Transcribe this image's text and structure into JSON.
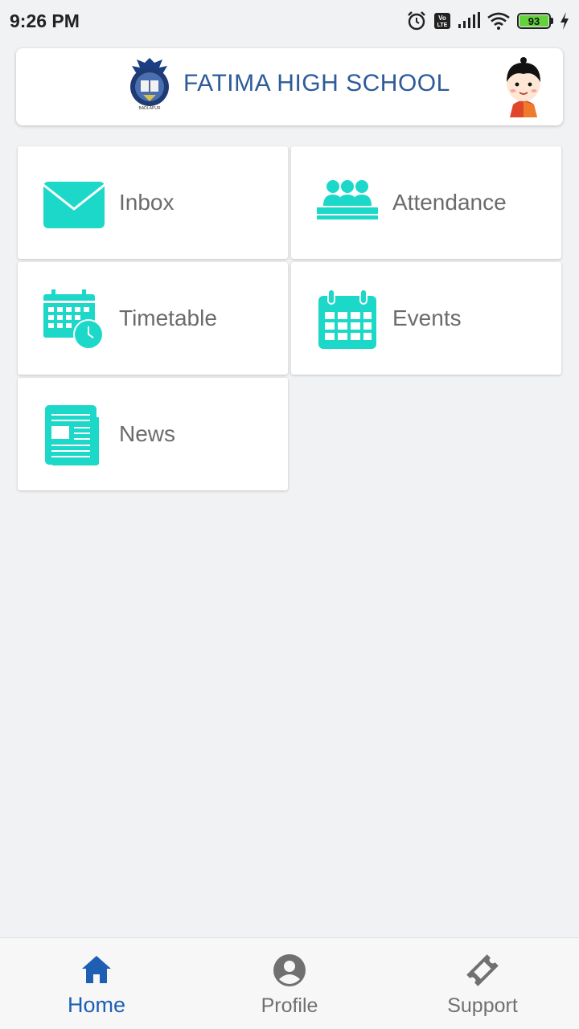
{
  "status_bar": {
    "time": "9:26 PM",
    "battery_level": "93",
    "icons": [
      "alarm-icon",
      "volte-icon",
      "signal-icon",
      "wifi-icon",
      "battery-icon",
      "charging-icon"
    ]
  },
  "header": {
    "school_name": "FATIMA HIGH SCHOOL",
    "logo_icon": "school-crest",
    "avatar_icon": "student-avatar"
  },
  "tiles": [
    {
      "label": "Inbox",
      "icon": "envelope-icon"
    },
    {
      "label": "Attendance",
      "icon": "attendance-icon"
    },
    {
      "label": "Timetable",
      "icon": "calendar-clock-icon"
    },
    {
      "label": "Events",
      "icon": "calendar-icon"
    },
    {
      "label": "News",
      "icon": "newspaper-icon"
    }
  ],
  "bottom_nav": {
    "items": [
      {
        "label": "Home",
        "icon": "home-icon",
        "active": true
      },
      {
        "label": "Profile",
        "icon": "profile-icon",
        "active": false
      },
      {
        "label": "Support",
        "icon": "ticket-icon",
        "active": false
      }
    ]
  },
  "colors": {
    "accent_teal": "#1cd8c8",
    "brand_blue": "#2e5b99",
    "nav_active": "#1e5fb3",
    "background": "#f1f2f4"
  }
}
